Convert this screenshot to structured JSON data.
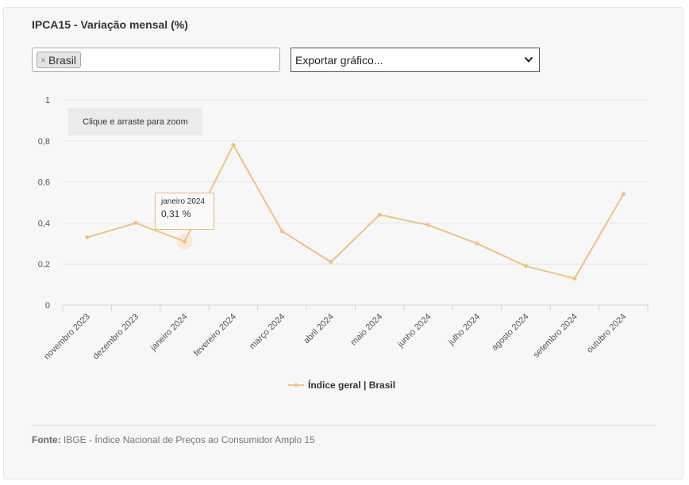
{
  "title": "IPCA15 - Variação mensal (%)",
  "filter": {
    "tags": [
      "Brasil"
    ],
    "remove_glyph": "×"
  },
  "export_select": {
    "value": "Exportar gráfico..."
  },
  "zoom_hint": "Clique e arraste para zoom",
  "tooltip": {
    "label": "janeiro 2024",
    "value": "0,31 %"
  },
  "footer": {
    "label": "Fonte:",
    "text": "IBGE - Índice Nacional de Preços ao Consumidor Amplo 15"
  },
  "colors": {
    "series": "#f0c27f",
    "grid": "#e6e6e6",
    "axis": "#ccd6eb"
  },
  "chart_data": {
    "type": "line",
    "categories": [
      "novembro 2023",
      "dezembro 2023",
      "janeiro 2024",
      "fevereiro 2024",
      "março 2024",
      "abril 2024",
      "maio 2024",
      "junho 2024",
      "julho 2024",
      "agosto 2024",
      "setembro 2024",
      "outubro 2024"
    ],
    "series": [
      {
        "name": "Índice geral | Brasil",
        "values": [
          0.33,
          0.4,
          0.31,
          0.78,
          0.36,
          0.21,
          0.44,
          0.39,
          0.3,
          0.19,
          0.13,
          0.54
        ]
      }
    ],
    "yticks": [
      "0",
      "0,2",
      "0,4",
      "0,6",
      "0,8",
      "1"
    ],
    "ylim": [
      0,
      1
    ],
    "grid": true,
    "legend": "bottom-center",
    "highlighted_category": "janeiro 2024"
  }
}
